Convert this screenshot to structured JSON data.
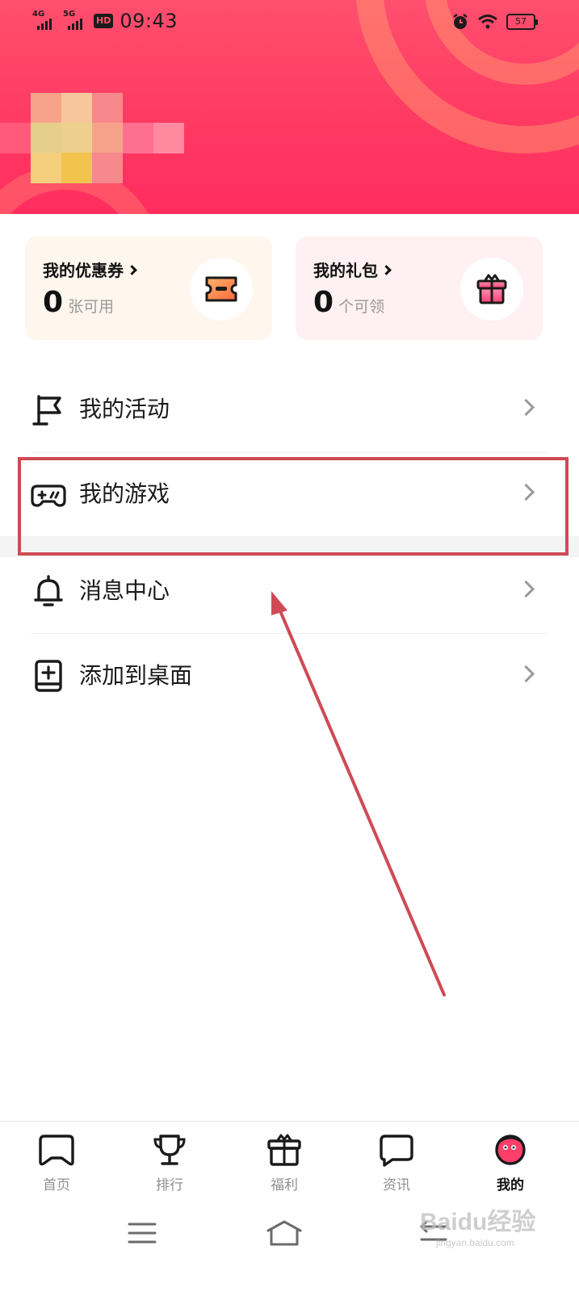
{
  "status_bar": {
    "net1": "4G",
    "net2": "5G",
    "hd": "HD",
    "time": "09:43",
    "battery": "57"
  },
  "cards": {
    "coupon": {
      "title": "我的优惠券",
      "count": "0",
      "unit": "张可用",
      "icon": "ticket-icon"
    },
    "gift": {
      "title": "我的礼包",
      "count": "0",
      "unit": "个可领",
      "icon": "gift-box-icon"
    }
  },
  "menu": {
    "activity": {
      "label": "我的活动",
      "icon": "flag-icon"
    },
    "games": {
      "label": "我的游戏",
      "icon": "gamepad-icon"
    },
    "messages": {
      "label": "消息中心",
      "icon": "bell-icon"
    },
    "desktop": {
      "label": "添加到桌面",
      "icon": "add-to-desktop-icon"
    }
  },
  "tabbar": {
    "home": "首页",
    "rank": "排行",
    "welfare": "福利",
    "news": "资讯",
    "mine": "我的",
    "active": "mine"
  },
  "watermark": {
    "brand": "Baidu经验",
    "url": "jingyan.baidu.com"
  },
  "colors": {
    "header": "#ff3a63",
    "highlight_box": "#cf4a55",
    "annotation_arrow": "#cf4a55"
  }
}
